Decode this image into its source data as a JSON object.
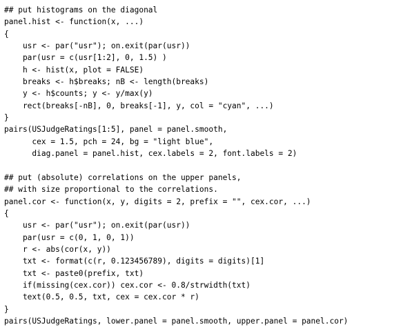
{
  "code": {
    "language": "R",
    "lines": [
      "## put histograms on the diagonal",
      "panel.hist <- function(x, ...)",
      "{",
      "    usr <- par(\"usr\"); on.exit(par(usr))",
      "    par(usr = c(usr[1:2], 0, 1.5) )",
      "    h <- hist(x, plot = FALSE)",
      "    breaks <- h$breaks; nB <- length(breaks)",
      "    y <- h$counts; y <- y/max(y)",
      "    rect(breaks[-nB], 0, breaks[-1], y, col = \"cyan\", ...)",
      "}",
      "pairs(USJudgeRatings[1:5], panel = panel.smooth,",
      "      cex = 1.5, pch = 24, bg = \"light blue\",",
      "      diag.panel = panel.hist, cex.labels = 2, font.labels = 2)",
      "",
      "## put (absolute) correlations on the upper panels,",
      "## with size proportional to the correlations.",
      "panel.cor <- function(x, y, digits = 2, prefix = \"\", cex.cor, ...)",
      "{",
      "    usr <- par(\"usr\"); on.exit(par(usr))",
      "    par(usr = c(0, 1, 0, 1))",
      "    r <- abs(cor(x, y))",
      "    txt <- format(c(r, 0.123456789), digits = digits)[1]",
      "    txt <- paste0(prefix, txt)",
      "    if(missing(cex.cor)) cex.cor <- 0.8/strwidth(txt)",
      "    text(0.5, 0.5, txt, cex = cex.cor * r)",
      "}",
      "pairs(USJudgeRatings, lower.panel = panel.smooth, upper.panel = panel.cor)"
    ]
  }
}
